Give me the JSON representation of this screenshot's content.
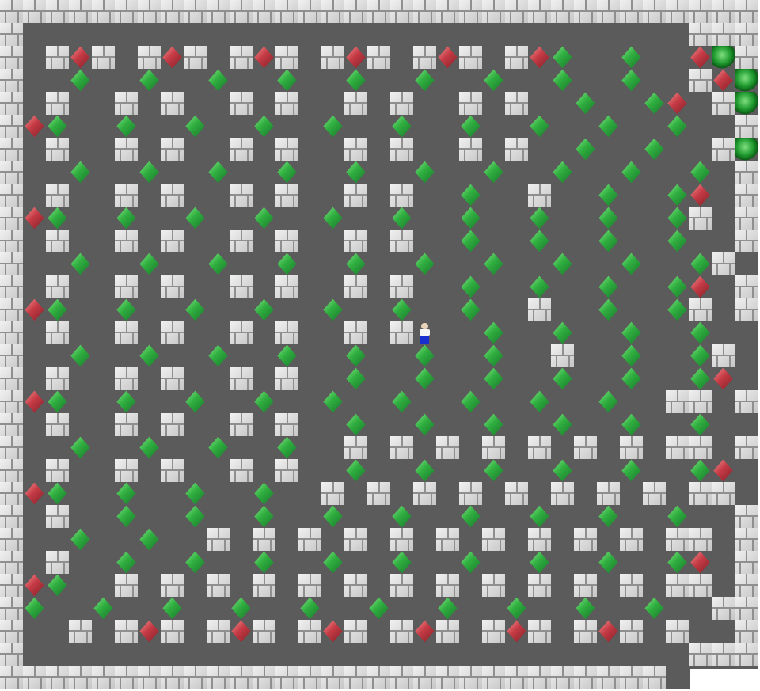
{
  "game": {
    "title": "",
    "grid": {
      "cols": 33,
      "rows": 30
    },
    "legend": {
      "#": "wall",
      " ": "floor",
      ".": "goal",
      "$": "box-on-floor",
      "*": "box-on-goal",
      "@": "player"
    },
    "colors": {
      "floor": "#5b5b5b",
      "wall": "#d9d9d9",
      "box_on_goal": "#2fae3f",
      "box_on_floor": "#c53b45",
      "goal": "#1f9a2f",
      "player_shirt": "#f4f4f4",
      "player_pants": "#1a2fd0"
    },
    "map": [
      "#################################",
      "#                             ###",
      "# #$# #$# #$# #$# #$# #$*  *  $.#",
      "#  *  *  *  *  *  *  *  *  *  #$.#",
      "# #  # #  # #  # #  # #  *  *$ #.#",
      "#$*  *  *  *  *  *  *  *  *  *  #.#",
      "# #  # #  # #  # #  # #  *  *  #.#",
      "#  *  *  *  *  *  *  *  *  *  * #.#",
      "# #  # #  # #  # #  *  #  *  *$ #.#",
      "#$*  *  *  *  *  *  *  *  *  *# #.#",
      "# #  # #  # #  # #  *  *  *  *  #.#",
      "#  *  *  *  *  *  *  *  *  *  *# #.#",
      "# #  # #  # #  # #  *  *  *  *$ #.#",
      "#$*  *  *  *  *  *  *  #  *  *# #.#",
      "# #  # #  # #  # #@  *  *  *  *  #.#",
      "#  *  *  *  *  *  *  *  #  *  *# #.#",
      "# #  # #  # #  *  *  *  *  *  *$ #.#",
      "#$*  *  *  *  *  *  *  *  *  ## #.#",
      "# #  # #  # #  *  *  *  *  *  *  #.#",
      "#  *  *  *  *  # # # # # # # ## #.#",
      "# #  # #  # #  *  *  *  *  *  *$ #.#",
      "#$*  *  *  *  # # # # # # # # ## #.#",
      "# #  *  *  *  *  *  *  *  *  *  #.#",
      "#  *  *  # # # # # # # # # # ## #.#",
      "# #  *  *  *  *  *  *  *  *  *$ #.#",
      "#$*  # # # # # # # # # # # # ## #.#",
      "#*  *  *  *  *  *  *  *  *  *  ###.#",
      "#  # #$# #$# #$# #$# #$# #$# #  #.#",
      "#                             ######",
      "#############################       "
    ]
  }
}
